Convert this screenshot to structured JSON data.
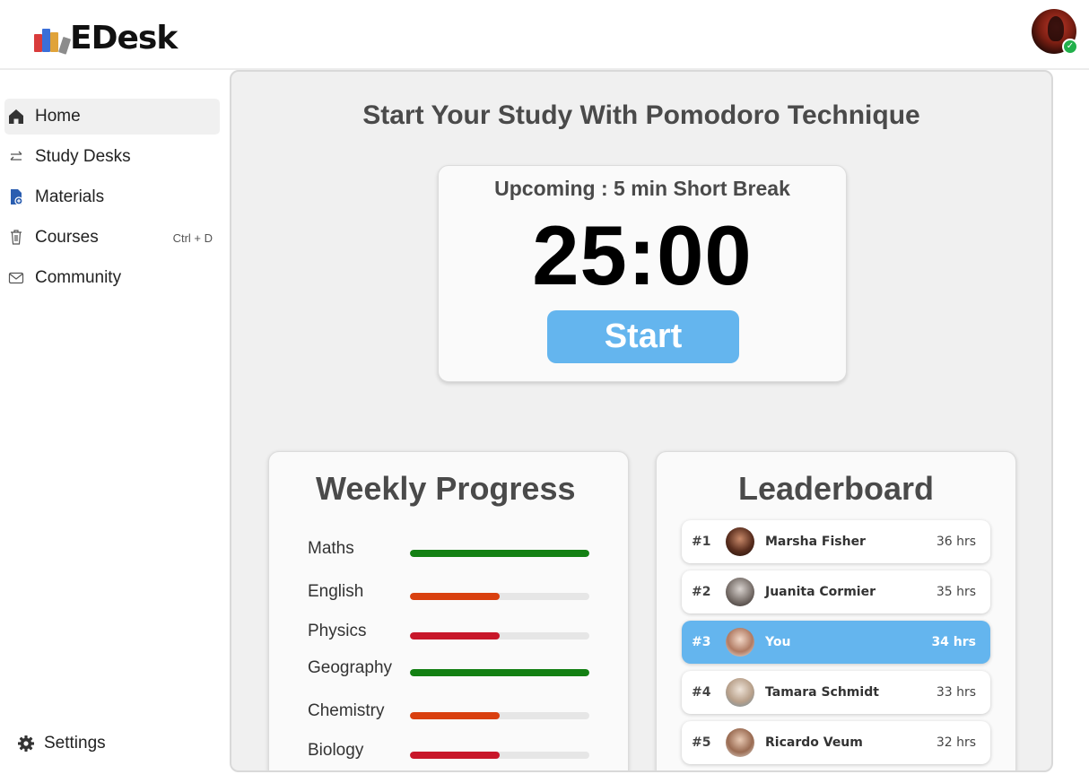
{
  "app": {
    "name": "EDesk"
  },
  "header": {
    "avatar_status": "online"
  },
  "sidebar": {
    "items": [
      {
        "label": "Home",
        "icon": "home-icon",
        "active": true,
        "shortcut": ""
      },
      {
        "label": "Study Desks",
        "icon": "swap-arrows-icon",
        "active": false,
        "shortcut": ""
      },
      {
        "label": "Materials",
        "icon": "document-add-icon",
        "active": false,
        "shortcut": ""
      },
      {
        "label": "Courses",
        "icon": "trash-icon",
        "active": false,
        "shortcut": "Ctrl + D"
      },
      {
        "label": "Community",
        "icon": "mail-icon",
        "active": false,
        "shortcut": ""
      }
    ],
    "settings_label": "Settings"
  },
  "main": {
    "title": "Start Your Study With Pomodoro Technique",
    "timer": {
      "upcoming": "Upcoming : 5 min Short Break",
      "time": "25:00",
      "start_label": "Start",
      "button_color": "#64b5ee"
    },
    "weekly_progress": {
      "title": "Weekly Progress",
      "subjects": [
        {
          "name": "Maths",
          "progress": 1.0,
          "color": "#138013"
        },
        {
          "name": "English",
          "progress": 0.5,
          "color": "#d9400f"
        },
        {
          "name": "Physics",
          "progress": 0.5,
          "color": "#c8172a"
        },
        {
          "name": "Geography",
          "progress": 1.0,
          "color": "#138013"
        },
        {
          "name": "Chemistry",
          "progress": 0.5,
          "color": "#d9400f"
        },
        {
          "name": "Biology",
          "progress": 0.5,
          "color": "#c8172a"
        }
      ]
    },
    "leaderboard": {
      "title": "Leaderboard",
      "entries": [
        {
          "rank": "#1",
          "name": "Marsha Fisher",
          "hours": "36 hrs",
          "me": false
        },
        {
          "rank": "#2",
          "name": "Juanita Cormier",
          "hours": "35 hrs",
          "me": false
        },
        {
          "rank": "#3",
          "name": "You",
          "hours": "34 hrs",
          "me": true
        },
        {
          "rank": "#4",
          "name": "Tamara Schmidt",
          "hours": "33 hrs",
          "me": false
        },
        {
          "rank": "#5",
          "name": "Ricardo Veum",
          "hours": "32 hrs",
          "me": false
        }
      ]
    }
  }
}
